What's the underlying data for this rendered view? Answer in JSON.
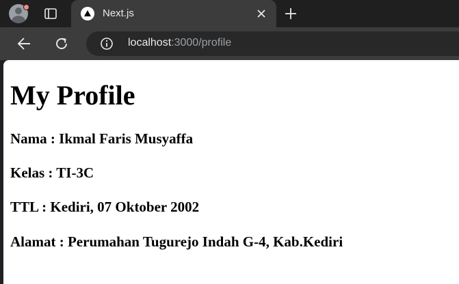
{
  "browser": {
    "tab": {
      "title": "Next.js",
      "favicon": "nextjs-triangle-icon"
    },
    "url": {
      "host": "localhost",
      "rest": ":3000/profile"
    },
    "icons": {
      "profile": "avatar-icon",
      "tab_actions": "tab-search-icon",
      "close": "close-icon",
      "new_tab": "plus-icon",
      "back": "back-arrow-icon",
      "reload": "reload-icon",
      "site_info": "info-icon"
    },
    "colors": {
      "tabstrip": "#1f1f1f",
      "toolbar": "#3c3c3c",
      "omnibox": "#282828",
      "profile_badge": "#f28b82"
    }
  },
  "page": {
    "heading": "My Profile",
    "fields": [
      {
        "text": "Nama : Ikmal Faris Musyaffa"
      },
      {
        "text": "Kelas : TI-3C"
      },
      {
        "text": "TTL : Kediri, 07 Oktober 2002"
      },
      {
        "text": "Alamat : Perumahan Tugurejo Indah G-4, Kab.Kediri"
      }
    ]
  }
}
